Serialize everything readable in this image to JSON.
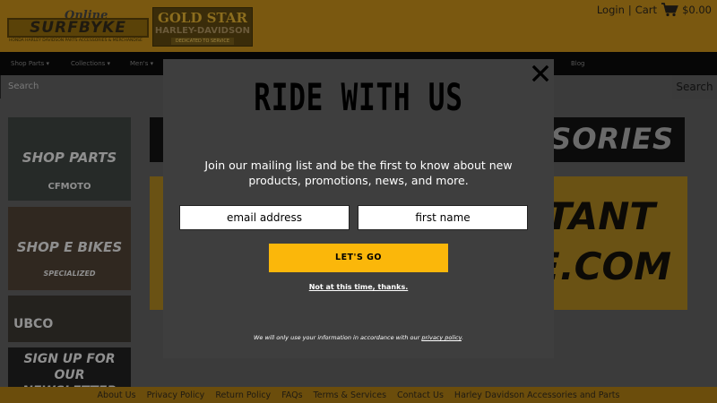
{
  "header": {
    "logo_script": "Online",
    "logo_word": "SURFBYKE",
    "logo_tagline": "HONDA HARLEY DAVIDSON PARTS ACCESSORIES & MERCHANDISE",
    "dealer_logo_top": "GOLD STAR",
    "dealer_logo_brand": "HARLEY-DAVIDSON",
    "dealer_logo_sub": "DEDICATED TO SERVICE",
    "login": "Login",
    "separator": "|",
    "cart": "Cart",
    "cart_total": "$0.00"
  },
  "nav": {
    "items": [
      "Shop Parts ▾",
      "Collections ▾",
      "Men's ▾",
      "Blog"
    ]
  },
  "search": {
    "placeholder": "Search",
    "button": "Search"
  },
  "tiles": {
    "shop_parts": "SHOP PARTS",
    "shop_parts_brand": "CFMOTO",
    "shop_ebikes": "SHOP E BIKES",
    "shop_ebikes_brand": "SPECIALIZED",
    "ubco": "UBCO",
    "newsletter": "SIGN UP FOR OUR NEWSLETTER"
  },
  "banners": {
    "top_text": "ESSORIES",
    "big_line1": "RTANT",
    "big_line2": "KE.COM"
  },
  "modal": {
    "title": "RIDE WITH US",
    "description": "Join our mailing list and be the first to know about new products, promotions, news, and more.",
    "email_placeholder": "email address",
    "name_placeholder": "first name",
    "submit": "LET'S GO",
    "decline": "Not at this time, thanks.",
    "privacy_prefix": "We will only use your information in accordance with our ",
    "privacy_link": "privacy policy",
    "privacy_suffix": "."
  },
  "footer": {
    "links": [
      "About Us",
      "Privacy Policy",
      "Return Policy",
      "FAQs",
      "Terms & Services",
      "Contact Us",
      "Harley Davidson Accessories and Parts"
    ]
  },
  "colors": {
    "header_bg": "#7a5810",
    "nav_bg": "#060606",
    "overlay_bg": "#3b3b3b",
    "modal_bg": "#3e3e3e",
    "cta": "#fbb70a",
    "footer_bg": "#6b4d0c"
  },
  "icons": {
    "cart": "shopping-cart-icon",
    "close": "close-icon"
  }
}
